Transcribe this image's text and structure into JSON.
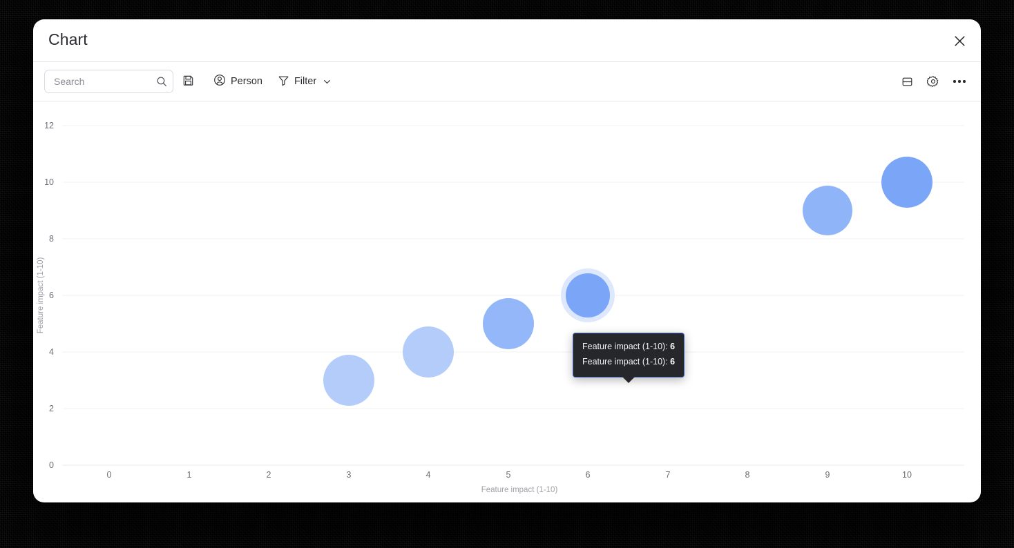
{
  "window": {
    "title": "Chart",
    "close_label": "✕"
  },
  "toolbar": {
    "search_placeholder": "Search",
    "search_value": "",
    "save_label": "",
    "person_label": "Person",
    "filter_label": "Filter",
    "layout_label": "",
    "settings_label": "",
    "more_label": ""
  },
  "tooltip": {
    "rows": [
      {
        "label": "Feature impact (1-10):",
        "value": "6"
      },
      {
        "label": "Feature impact (1-10):",
        "value": "6"
      }
    ],
    "row0_label": "Feature impact (1-10):",
    "row0_value": "6",
    "row1_label": "Feature impact (1-10):",
    "row1_value": "6"
  },
  "colors": {
    "bubble_light": "#B3CCFA",
    "bubble_mid": "#8FB5F8",
    "bubble_dark": "#6F9BF0",
    "bubble_halo": "#DEE8FD",
    "gridline": "#F0F0F1",
    "tooltip_bg": "#26272B",
    "tooltip_border": "#4A6CC4",
    "divider": "#E4E4EC"
  },
  "chart_data": {
    "type": "scatter",
    "title": "",
    "xlabel": "Feature impact (1-10)",
    "ylabel": "Feature impact (1-10)",
    "xlim": [
      0,
      10
    ],
    "ylim": [
      0,
      12
    ],
    "xticks": [
      "0",
      "1",
      "2",
      "3",
      "4",
      "5",
      "6",
      "7",
      "8",
      "9",
      "10"
    ],
    "yticks": [
      "0",
      "2",
      "4",
      "6",
      "8",
      "10",
      "12"
    ],
    "grid": true,
    "legend": "none",
    "series": [
      {
        "name": "Feature impact (1-10)",
        "points": [
          {
            "x": 3,
            "y": 3,
            "r": 37,
            "color": "#B3CCFA",
            "hovered": false
          },
          {
            "x": 4,
            "y": 4,
            "r": 37,
            "color": "#B3CCFA",
            "hovered": false
          },
          {
            "x": 5,
            "y": 5,
            "r": 37,
            "color": "#93B7F8",
            "hovered": false
          },
          {
            "x": 6,
            "y": 6,
            "r": 33,
            "color": "#7BA6F7",
            "hovered": true
          },
          {
            "x": 9,
            "y": 9,
            "r": 36,
            "color": "#8FB5F8",
            "hovered": false
          },
          {
            "x": 10,
            "y": 10,
            "r": 37,
            "color": "#7BA6F7",
            "hovered": false
          }
        ]
      }
    ]
  }
}
